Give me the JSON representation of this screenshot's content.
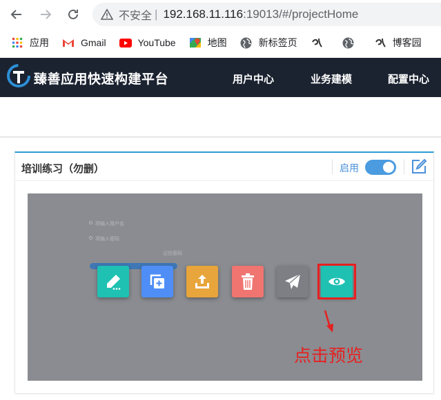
{
  "browser": {
    "insecure_label": "不安全",
    "separator": "|",
    "url_host": "192.168.11.116",
    "url_path": ":19013/#/projectHome"
  },
  "bookmarks": [
    {
      "label": "应用",
      "icon": "apps-grid-icon"
    },
    {
      "label": "Gmail",
      "icon": "gmail-icon"
    },
    {
      "label": "YouTube",
      "icon": "youtube-icon"
    },
    {
      "label": "地图",
      "icon": "maps-icon"
    },
    {
      "label": "新标签页",
      "icon": "globe-icon"
    },
    {
      "label": "",
      "icon": "custom-site-icon"
    },
    {
      "label": "",
      "icon": "globe-icon"
    },
    {
      "label": "博客园",
      "icon": "custom-site-icon"
    }
  ],
  "header": {
    "title": "臻善应用快速构建平台",
    "menu": [
      "用户中心",
      "业务建模",
      "配置中心"
    ]
  },
  "card": {
    "title": "培训练习（勿删）",
    "enable_label": "启用",
    "enabled": true
  },
  "preview": {
    "faint_texts": [
      "项输入用户名",
      "项输入密码",
      "记住密码"
    ],
    "actions": [
      {
        "name": "edit",
        "icon": "pencil-icon",
        "color": "#1fc1b3"
      },
      {
        "name": "copy",
        "icon": "copy-add-icon",
        "color": "#4f8ef7"
      },
      {
        "name": "export",
        "icon": "upload-icon",
        "color": "#e8a53b"
      },
      {
        "name": "delete",
        "icon": "trash-icon",
        "color": "#f07470"
      },
      {
        "name": "publish",
        "icon": "paper-plane-icon",
        "color": "#7d7f84"
      },
      {
        "name": "preview",
        "icon": "eye-icon",
        "color": "#1fc1b3"
      }
    ],
    "annotation": "点击预览",
    "annotation_color": "#e62020"
  }
}
